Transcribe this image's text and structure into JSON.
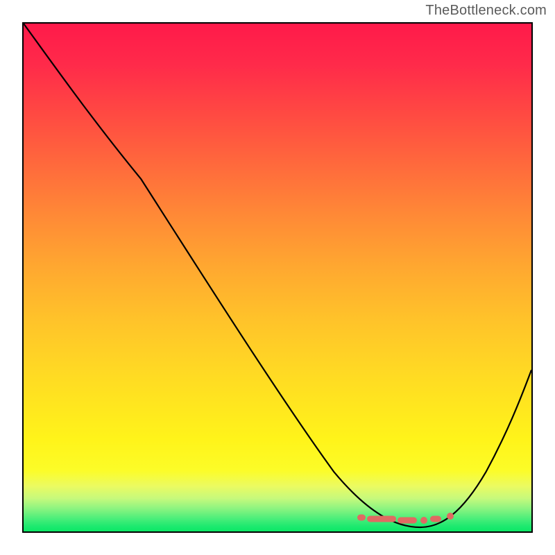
{
  "watermark": "TheBottleneck.com",
  "chart_data": {
    "type": "line",
    "title": "",
    "xlabel": "",
    "ylabel": "",
    "xlim": [
      0,
      100
    ],
    "ylim": [
      0,
      100
    ],
    "grid": false,
    "series": [
      {
        "name": "bottleneck-curve",
        "x": [
          0,
          6,
          12,
          18,
          24,
          30,
          36,
          42,
          48,
          54,
          60,
          66,
          70,
          74,
          78,
          82,
          86,
          90,
          94,
          100
        ],
        "y": [
          100,
          94,
          87,
          80,
          72,
          63,
          55,
          46,
          38,
          29,
          21,
          12,
          7,
          3,
          1,
          1,
          3,
          8,
          16,
          30
        ],
        "color": "#000000"
      }
    ],
    "optimal_points": {
      "name": "optimal-zone-markers",
      "color": "#e06a62",
      "x": [
        68,
        72,
        76,
        78.5,
        81,
        84
      ],
      "y": [
        2,
        1.5,
        1.3,
        1.3,
        1.5,
        2
      ]
    },
    "background_gradient": {
      "top_color": "#ff1a4a",
      "mid_color": "#ffe81e",
      "bottom_color": "#0ce866"
    }
  }
}
